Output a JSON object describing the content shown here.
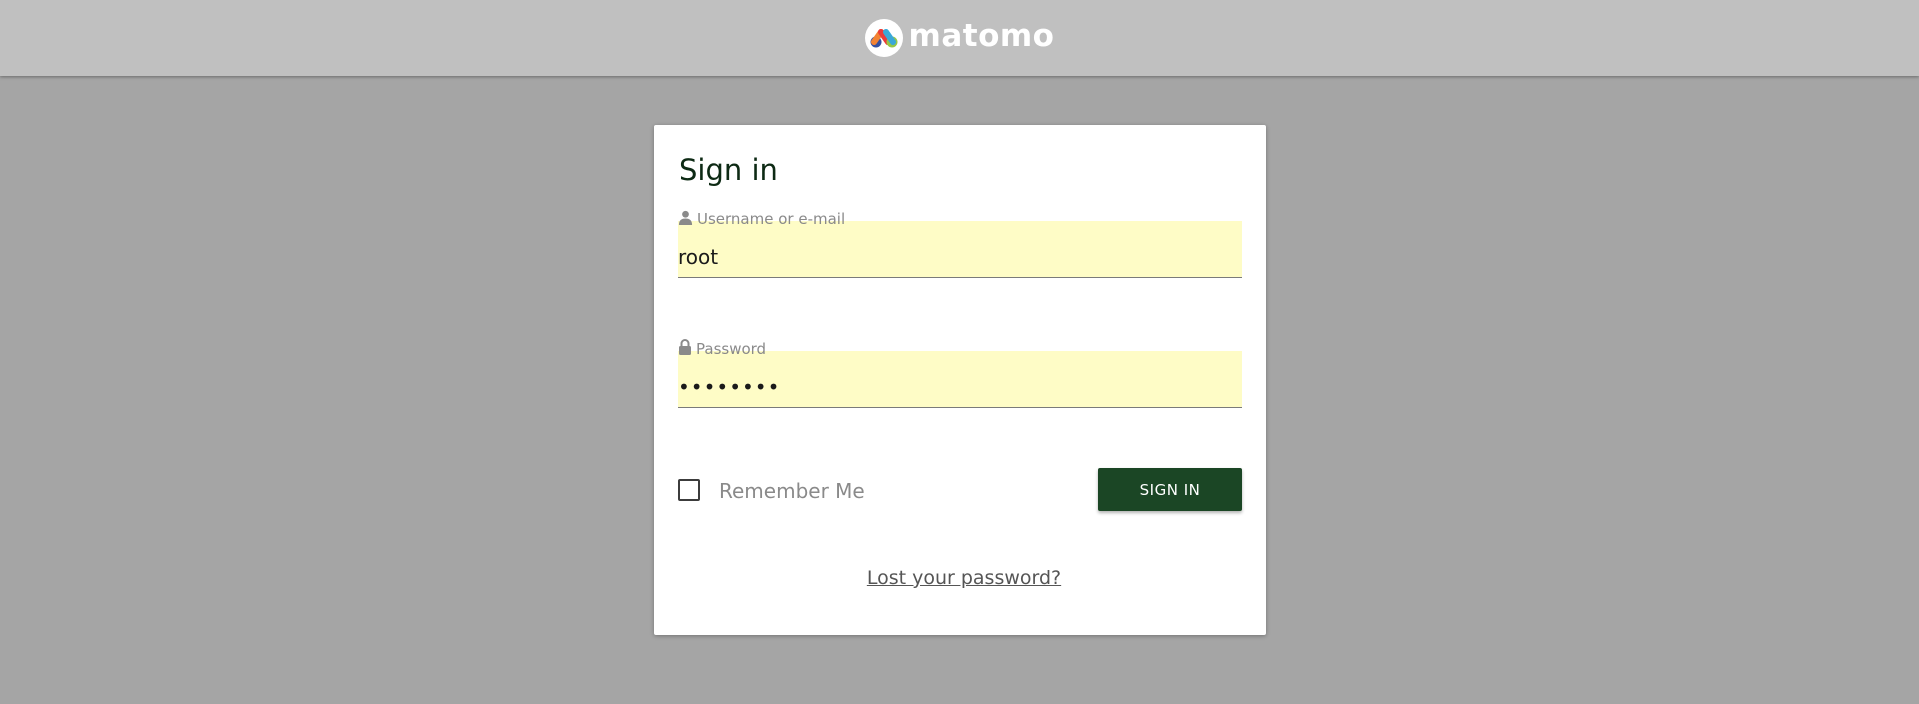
{
  "header": {
    "logo_text": "matomo",
    "logo_icon": "matomo-logo-icon"
  },
  "login": {
    "title": "Sign in",
    "username": {
      "label": "Username or e-mail",
      "value": "root",
      "icon": "user-icon"
    },
    "password": {
      "label": "Password",
      "value": "12345678",
      "icon": "lock-icon"
    },
    "remember_label": "Remember Me",
    "remember_checked": false,
    "submit_label": "SIGN IN",
    "lost_password_label": "Lost your password?"
  },
  "colors": {
    "page_background": "#a5a5a5",
    "header_background": "#c0c0c0",
    "input_autofill_background": "#fefcc6",
    "button_background": "#1b4625",
    "title_color": "#0d2a14"
  }
}
